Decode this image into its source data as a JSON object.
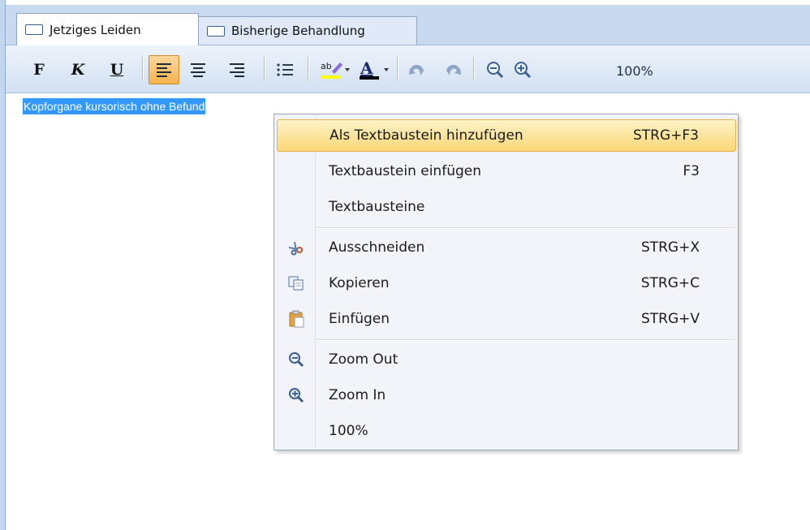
{
  "tabs": [
    {
      "label": "Jetziges Leiden",
      "active": true
    },
    {
      "label": "Bisherige Behandlung",
      "active": false
    }
  ],
  "toolbar": {
    "bold": "F",
    "italic": "K",
    "underline": "U",
    "zoom": "100%"
  },
  "editor": {
    "selected_text": "Kopforgane kursorisch ohne Befund"
  },
  "context_menu": {
    "items": [
      {
        "label": "Als Textbaustein hinzufügen",
        "shortcut": "STRG+F3",
        "highlighted": true,
        "icon": ""
      },
      {
        "label": "Textbaustein einfügen",
        "shortcut": "F3",
        "icon": ""
      },
      {
        "label": "Textbausteine",
        "shortcut": "",
        "icon": ""
      },
      {
        "label": "Ausschneiden",
        "shortcut": "STRG+X",
        "icon": "scissors-icon"
      },
      {
        "label": "Kopieren",
        "shortcut": "STRG+C",
        "icon": "copy-icon"
      },
      {
        "label": "Einfügen",
        "shortcut": "STRG+V",
        "icon": "paste-icon"
      },
      {
        "label": "Zoom Out",
        "shortcut": "",
        "icon": "zoom-out-icon"
      },
      {
        "label": "Zoom In",
        "shortcut": "",
        "icon": "zoom-in-icon"
      },
      {
        "label": "100%",
        "shortcut": "",
        "icon": ""
      }
    ]
  },
  "colors": {
    "selection": "#3399ff",
    "highlight": "#fbd776",
    "tabbar": "#c9daf0"
  }
}
